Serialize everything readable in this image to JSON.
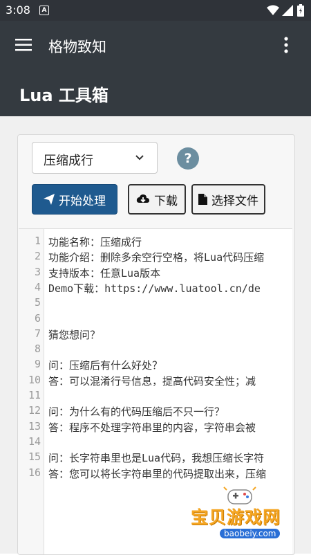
{
  "status_bar": {
    "time": "3:08",
    "notification_icon": "A"
  },
  "app_bar": {
    "title": "格物致知"
  },
  "header": {
    "title": "Lua 工具箱"
  },
  "controls": {
    "mode_select": {
      "value": "压缩成行"
    },
    "help_label": "?",
    "start_button": "开始处理",
    "download_button": "下载",
    "choose_file_button": "选择文件"
  },
  "editor": {
    "line_numbers": [
      "1",
      "2",
      "3",
      "4",
      "5",
      "6",
      "7",
      "8",
      "9",
      "10",
      "11",
      "12",
      "13",
      "14",
      "15",
      "16"
    ],
    "lines": [
      "功能名称：压缩成行",
      "功能介绍：删除多余空行空格，将Lua代码压缩",
      "支持版本：任意Lua版本",
      "Demo下载：https://www.luatool.cn/de",
      "",
      "",
      "猜您想问？",
      "",
      "问：压缩后有什么好处？",
      "答：可以混淆行号信息，提高代码安全性；减",
      "",
      "问：为什么有的代码压缩后不只一行？",
      "答：程序不处理字符串里的内容，字符串会被",
      "",
      "问：长字符串里也是Lua代码，我想压缩长字符",
      "答：您可以将长字符串里的代码提取出来，压缩"
    ]
  },
  "watermark": {
    "text": "宝贝游戏网",
    "url": "baobeiy.com"
  },
  "colors": {
    "app_bar": "#343a40",
    "primary_button": "#1f5a8f",
    "help": "#6c8ea0",
    "watermark": "#f5a623"
  }
}
